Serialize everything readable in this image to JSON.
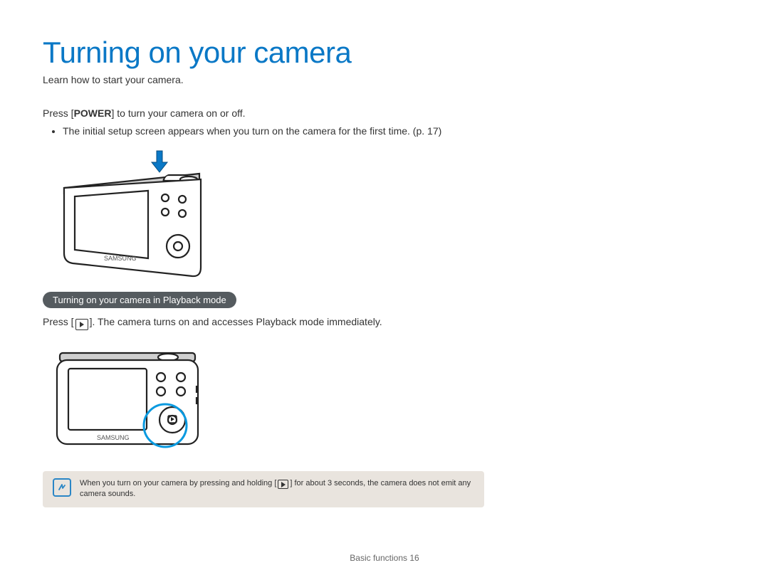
{
  "title": "Turning on your camera",
  "subtitle": "Learn how to start your camera.",
  "power_line_pre": "Press [",
  "power_line_bold": "POWER",
  "power_line_post": "] to turn your camera on or off.",
  "bullet1": "The initial setup screen appears when you turn on the camera for the first time. (p. 17)",
  "playback_pill": "Turning on your camera in Playback mode",
  "playback_para_pre": "Press [",
  "playback_para_post": "]. The camera turns on and accesses Playback mode immediately.",
  "note_pre": "When you turn on your camera by pressing and holding [",
  "note_post": "] for about 3 seconds, the camera does not emit any camera sounds.",
  "footer_section": "Basic functions ",
  "footer_page": "16",
  "brand": "SAMSUNG"
}
